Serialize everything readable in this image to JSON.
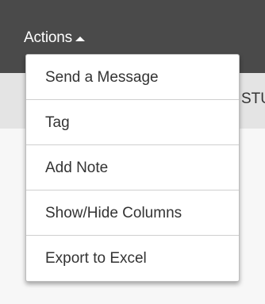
{
  "header": {
    "actions_label": "Actions"
  },
  "table": {
    "partial_column_header": "STU"
  },
  "dropdown": {
    "items": [
      {
        "label": "Send a Message"
      },
      {
        "label": "Tag"
      },
      {
        "label": "Add Note"
      },
      {
        "label": "Show/Hide Columns"
      },
      {
        "label": "Export to Excel"
      }
    ]
  },
  "colors": {
    "header_bg": "#4a4a4a",
    "subbar_bg": "#e4e4e4",
    "menu_bg": "#ffffff",
    "text": "#333333"
  },
  "icons": {
    "actions_caret": "caret-up-icon"
  }
}
